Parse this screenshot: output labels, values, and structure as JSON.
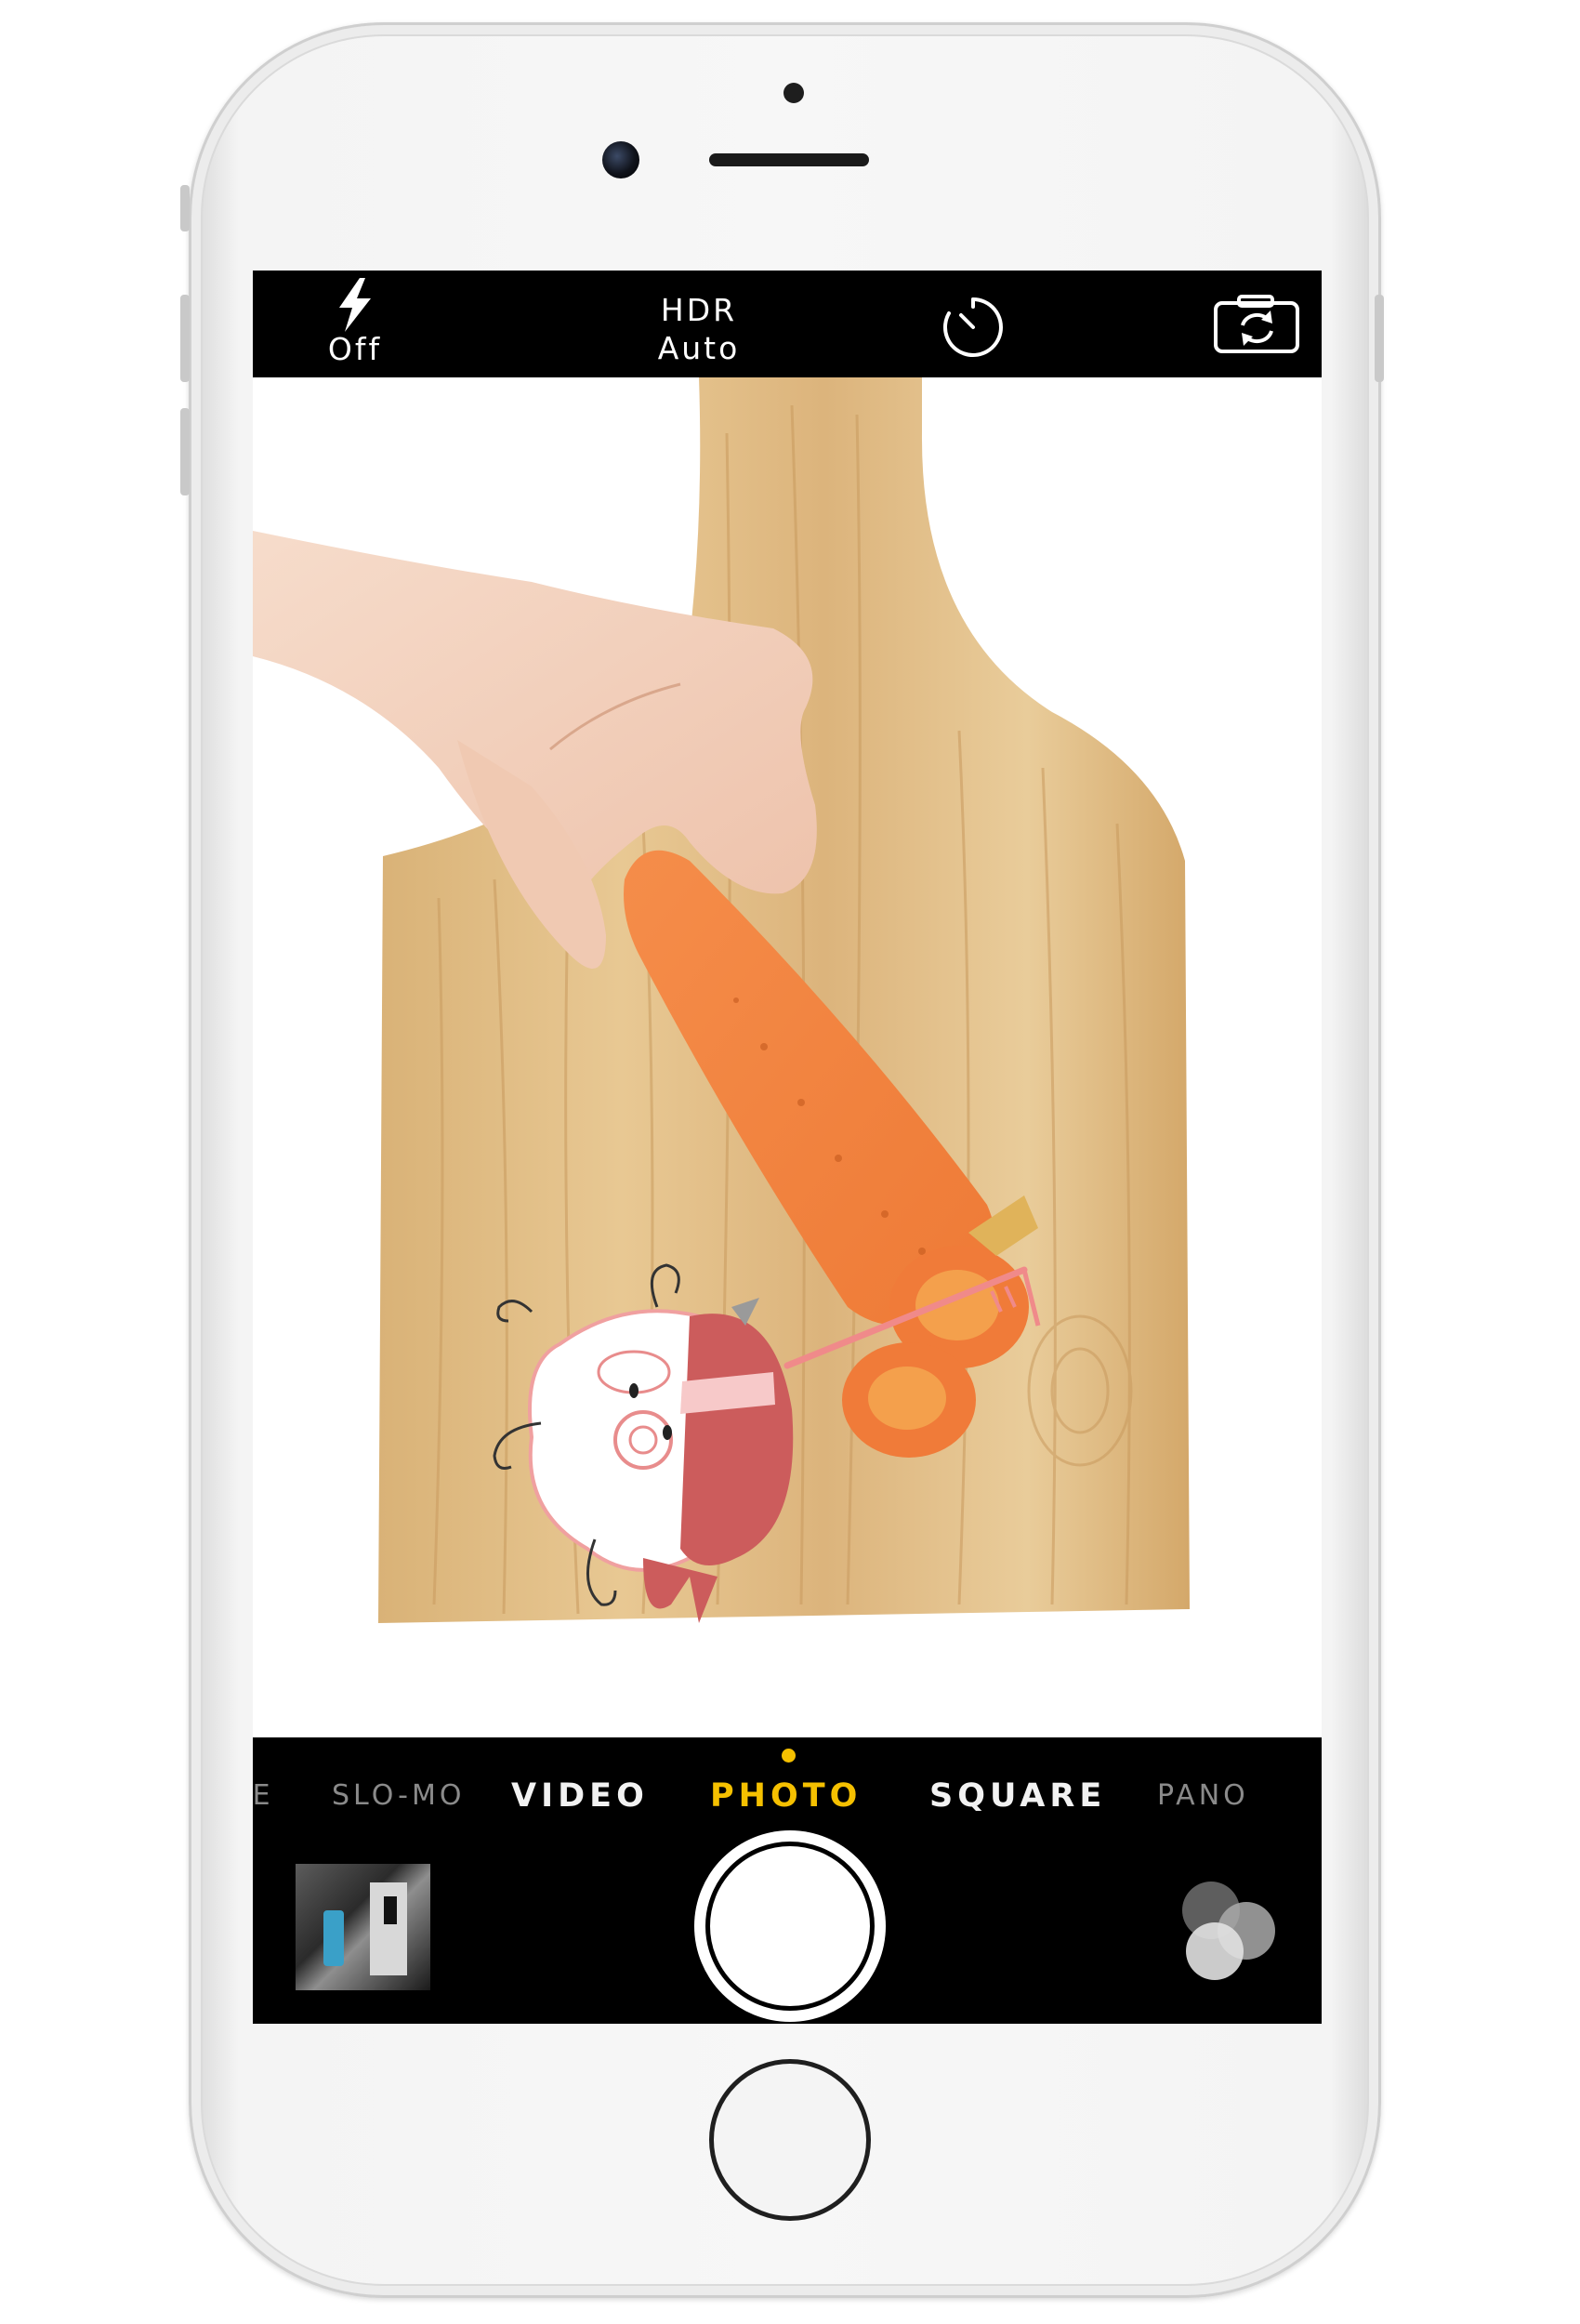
{
  "top_bar": {
    "flash": {
      "icon": "flash-icon",
      "label": "Off"
    },
    "hdr": {
      "title": "HDR",
      "value": "Auto"
    },
    "timer": {
      "icon": "timer-icon"
    },
    "switch_camera": {
      "icon": "switch-camera-icon"
    }
  },
  "viewfinder": {
    "scene": "hand-cutting-carrot-on-wooden-board",
    "sticker": "sheep-sticker"
  },
  "modes": {
    "items": [
      {
        "label": "APSE",
        "state": "faded"
      },
      {
        "label": "SLO-MO",
        "state": "faded"
      },
      {
        "label": "VIDEO",
        "state": "inactive"
      },
      {
        "label": "PHOTO",
        "state": "active"
      },
      {
        "label": "SQUARE",
        "state": "inactive"
      },
      {
        "label": "PANO",
        "state": "faded"
      }
    ],
    "indicator_color": "#f5c000"
  },
  "bottom_bar": {
    "thumbnail": "last-photo-thumbnail",
    "shutter": "shutter-button",
    "filters": "filters-icon"
  },
  "colors": {
    "accent": "#f5c000",
    "bar_bg": "#000000",
    "text": "#ffffff"
  }
}
